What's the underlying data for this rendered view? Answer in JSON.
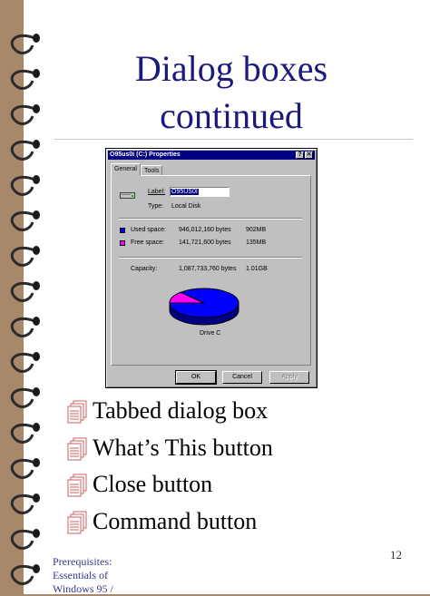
{
  "slide": {
    "title_line1": "Dialog boxes",
    "title_line2": "continued",
    "bullets": [
      "Tabbed dialog box",
      "What’s This button",
      "Close button",
      "Command button"
    ],
    "footer_text": "Prerequisites: Essentials of Windows 95 / ",
    "page_number": "12"
  },
  "dialog": {
    "title": "O95us0i (C:) Properties",
    "help_button": "?",
    "close_button": "✕",
    "tabs": [
      "General",
      "Tools"
    ],
    "label_caption": "Label:",
    "label_value": "O95US0I",
    "type_caption": "Type:",
    "type_value": "Local Disk",
    "used_caption": "Used space:",
    "used_bytes": "946,012,160 bytes",
    "used_mb": "902MB",
    "free_caption": "Free space:",
    "free_bytes": "141,721,600 bytes",
    "free_mb": "135MB",
    "capacity_caption": "Capacity:",
    "capacity_bytes": "1,087,733,760 bytes",
    "capacity_gb": "1.01GB",
    "drive_caption": "Drive C",
    "ok_label": "OK",
    "cancel_label": "Cancel",
    "apply_label": "Apply",
    "used_fraction": 0.87,
    "colors": {
      "used": "#0000ff",
      "free": "#ff00ff",
      "titlebar": "#000080"
    }
  }
}
